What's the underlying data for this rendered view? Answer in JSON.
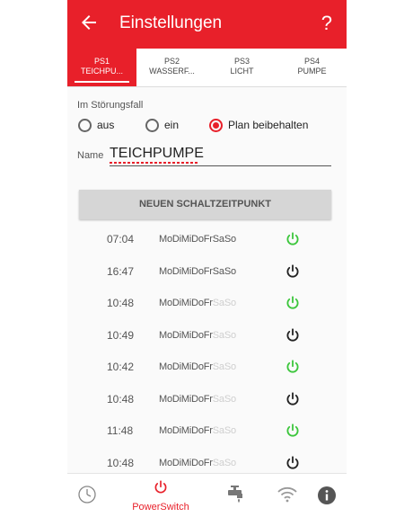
{
  "header": {
    "title": "Einstellungen",
    "help": "?"
  },
  "tabs": [
    {
      "line1": "PS1",
      "line2": "TEICHPU...",
      "active": true
    },
    {
      "line1": "PS2",
      "line2": "WASSERF...",
      "active": false
    },
    {
      "line1": "PS3",
      "line2": "LICHT",
      "active": false
    },
    {
      "line1": "PS4",
      "line2": "PUMPE",
      "active": false
    }
  ],
  "failure": {
    "label": "Im Störungsfall",
    "options": [
      {
        "label": "aus",
        "checked": false
      },
      {
        "label": "ein",
        "checked": false
      },
      {
        "label": "Plan beibehalten",
        "checked": true
      }
    ]
  },
  "name": {
    "label": "Name",
    "value": "TEICHPUMPE"
  },
  "new_button": "NEUEN SCHALTZEITPUNKT",
  "day_labels": [
    "Mo",
    "Di",
    "Mi",
    "Do",
    "Fr",
    "Sa",
    "So"
  ],
  "schedule": [
    {
      "time": "07:04",
      "days_active": [
        true,
        true,
        true,
        true,
        true,
        true,
        true
      ],
      "state": "on"
    },
    {
      "time": "16:47",
      "days_active": [
        true,
        true,
        true,
        true,
        true,
        true,
        true
      ],
      "state": "off"
    },
    {
      "time": "10:48",
      "days_active": [
        true,
        true,
        true,
        true,
        true,
        false,
        false
      ],
      "state": "on"
    },
    {
      "time": "10:49",
      "days_active": [
        true,
        true,
        true,
        true,
        true,
        false,
        false
      ],
      "state": "off"
    },
    {
      "time": "10:42",
      "days_active": [
        true,
        true,
        true,
        true,
        true,
        false,
        false
      ],
      "state": "on"
    },
    {
      "time": "10:48",
      "days_active": [
        true,
        true,
        true,
        true,
        true,
        false,
        false
      ],
      "state": "off"
    },
    {
      "time": "11:48",
      "days_active": [
        true,
        true,
        true,
        true,
        true,
        false,
        false
      ],
      "state": "on"
    },
    {
      "time": "10:48",
      "days_active": [
        true,
        true,
        true,
        true,
        true,
        false,
        false
      ],
      "state": "off"
    }
  ],
  "nav": {
    "active_label": "PowerSwitch"
  },
  "colors": {
    "accent": "#e8202a",
    "on": "#3cc63c",
    "off": "#222222",
    "day_inactive": "#cfcfcf"
  },
  "icons": [
    "back-arrow-icon",
    "help-icon",
    "clock-icon",
    "power-icon",
    "faucet-icon",
    "wifi-icon",
    "info-icon"
  ]
}
